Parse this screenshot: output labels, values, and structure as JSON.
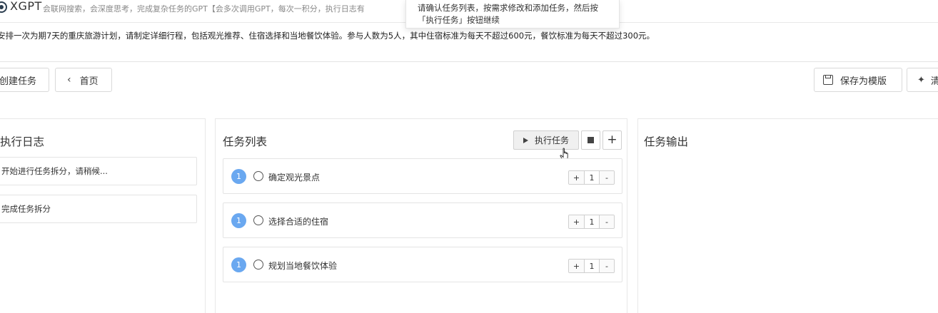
{
  "header": {
    "app_name": "XGPT",
    "description": "会联网搜索，会深度思考，完成复杂任务的GPT【会多次调用GPT，每次一积分，执行日志有"
  },
  "tooltip": {
    "line1": "请确认任务列表，按需求修改和添加任务，然后按",
    "line2": "「执行任务」按钮继续"
  },
  "prompt": "安排一次为期7天的重庆旅游计划，请制定详细行程，包括观光推荐、住宿选择和当地餐饮体验。参与人数为5人，其中住宿标准为每天不超过600元，餐饮标准为每天不超过300元。",
  "toolbar": {
    "create_label": "创建任务",
    "home_label": "首页",
    "save_label": "保存为模版",
    "clear_label": "清"
  },
  "log_panel": {
    "title": "执行日志",
    "items": [
      "开始进行任务拆分，请稍候...",
      "完成任务拆分"
    ]
  },
  "task_panel": {
    "title": "任务列表",
    "run_label": "执行任务",
    "tasks": [
      {
        "index": "1",
        "label": "确定观光景点",
        "count": "1"
      },
      {
        "index": "1",
        "label": "选择合适的住宿",
        "count": "1"
      },
      {
        "index": "1",
        "label": "规划当地餐饮体验",
        "count": "1"
      }
    ],
    "stepper_plus": "+",
    "stepper_minus": "-"
  },
  "output_panel": {
    "title": "任务输出"
  },
  "colors": {
    "badge": "#6aa8f0",
    "border": "#e4e4e4"
  }
}
